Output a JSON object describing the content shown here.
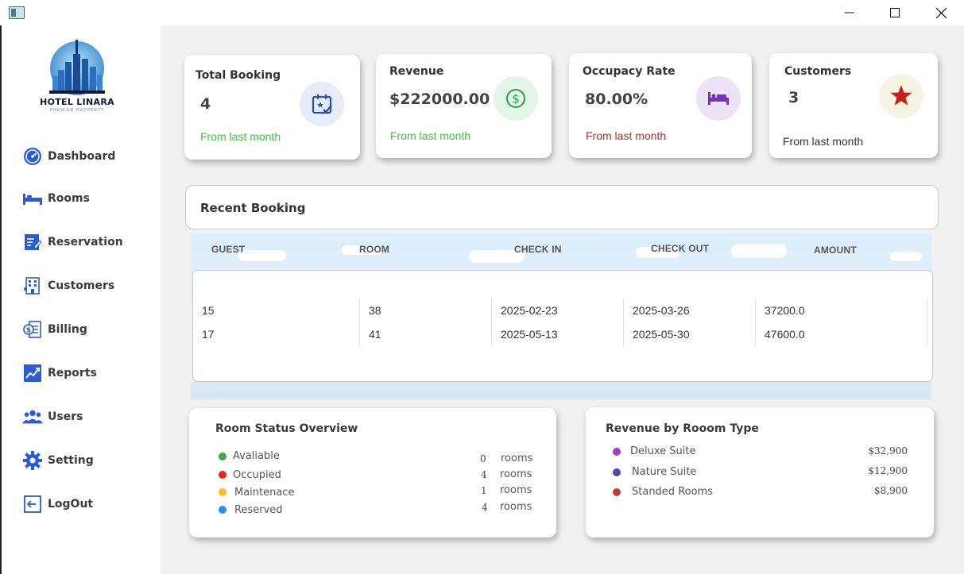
{
  "window": {
    "controls": {
      "minimize": "—",
      "maximize": "☐",
      "close": "✕"
    }
  },
  "brand": {
    "name": "HOTEL LINARA",
    "tagline": "PREMIUM PROPERTY"
  },
  "sidebar": {
    "items": [
      {
        "label": "Dashboard",
        "icon": "dashboard-gauge-icon"
      },
      {
        "label": "Rooms",
        "icon": "bed-icon"
      },
      {
        "label": "Reservation",
        "icon": "clipboard-edit-icon"
      },
      {
        "label": "Customers",
        "icon": "building-people-icon"
      },
      {
        "label": "Billing",
        "icon": "invoice-dollar-icon"
      },
      {
        "label": "Reports",
        "icon": "trending-chart-icon"
      },
      {
        "label": "Users",
        "icon": "users-group-icon"
      },
      {
        "label": "Setting",
        "icon": "gear-icon"
      },
      {
        "label": "LogOut",
        "icon": "logout-icon"
      }
    ],
    "icon_color": "#2b5bd7"
  },
  "stats": {
    "total_booking": {
      "title": "Total Booking",
      "value": "4",
      "foot": "From last month",
      "foot_color": "#3cc43c",
      "icon": "calendar-check-icon",
      "icon_bg": "#e6ecf8",
      "icon_color": "#2b4fb8"
    },
    "revenue": {
      "title": "Revenue",
      "value": "$222000.00",
      "foot": "From last month",
      "foot_color": "#3cc43c",
      "icon": "dollar-circle-icon",
      "icon_bg": "#e3f5e8",
      "icon_color": "#27a046"
    },
    "occupancy": {
      "title": "Occupacy Rate",
      "value": "80.00%",
      "foot": "From last month",
      "foot_color": "#c0282d",
      "icon": "bed-icon",
      "icon_bg": "#ede3f7",
      "icon_color": "#7a2fc0"
    },
    "customers": {
      "title": "Customers",
      "value": "3",
      "foot": "From last month",
      "foot_color": "#333333",
      "icon": "star-icon",
      "icon_bg": "#f6f4e3",
      "icon_color": "#c81e1e"
    }
  },
  "recent_booking": {
    "title": "Recent Booking",
    "columns": [
      "GUEST",
      "ROOM",
      "CHECK IN",
      "CHECK OUT",
      "AMOUNT"
    ],
    "rows": [
      [
        "15",
        "38",
        "2025-02-23",
        "2025-03-26",
        "37200.0"
      ],
      [
        "17",
        "41",
        "2025-05-13",
        "2025-05-30",
        "47600.0"
      ]
    ]
  },
  "room_status": {
    "title": "Room Status Overview",
    "items": [
      {
        "label": "Avaliable",
        "count": "0",
        "unit": "rooms",
        "color": "#3ea84a"
      },
      {
        "label": "Occupied",
        "count": "4",
        "unit": "rooms",
        "color": "#e8281e"
      },
      {
        "label": "Maintenace",
        "count": "1",
        "unit": "rooms",
        "color": "#f2c21b"
      },
      {
        "label": "Reserved",
        "count": "4",
        "unit": "rooms",
        "color": "#2b8df0"
      }
    ]
  },
  "revenue_by_type": {
    "title": "Revenue by Rooom Type",
    "items": [
      {
        "label": "Deluxe Suite",
        "amount": "$32,900",
        "color": "#9b3fc0"
      },
      {
        "label": "Nature Suite",
        "amount": "$12,900",
        "color": "#4a46b8"
      },
      {
        "label": "Standed Rooms",
        "amount": "$8,900",
        "color": "#b8403c"
      }
    ]
  }
}
